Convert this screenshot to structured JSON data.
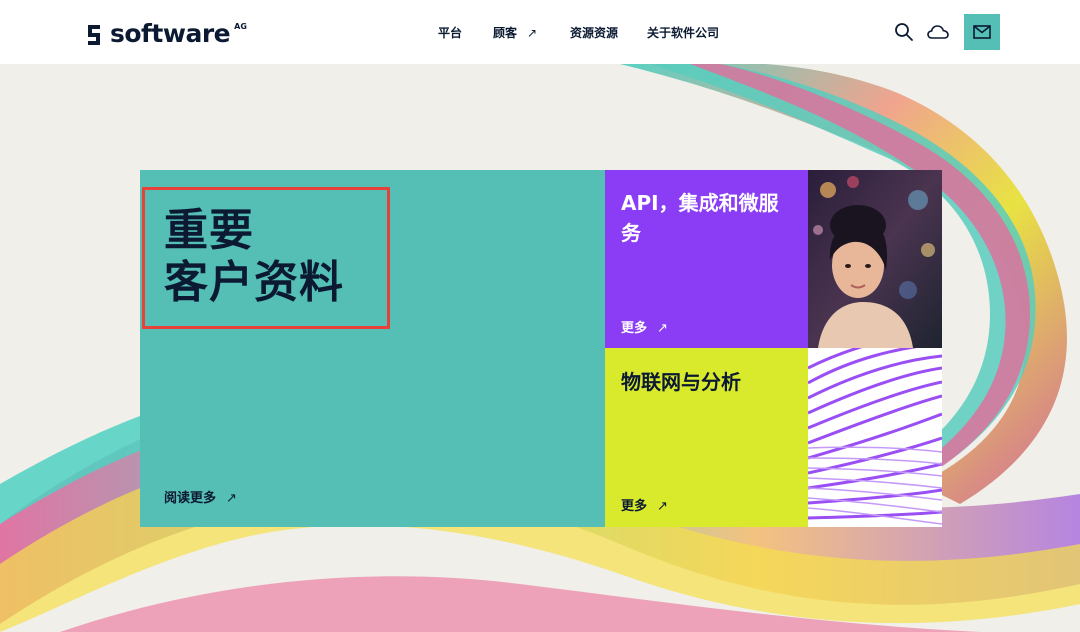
{
  "brand": {
    "name": "software",
    "suffix": "AG"
  },
  "nav": {
    "items": [
      {
        "label": "平台"
      },
      {
        "label": "顾客",
        "arrow": "↗"
      },
      {
        "label": "资源资源"
      },
      {
        "label": "关于软件公司"
      }
    ]
  },
  "header_icons": {
    "search": "search-icon",
    "cloud": "cloud-icon",
    "mail": "mail-icon"
  },
  "hero": {
    "title_line1": "重要",
    "title_line2": "客户资料",
    "read_more": "阅读更多",
    "arrow": "↗"
  },
  "cards": {
    "api": {
      "title": "API，集成和微服务",
      "more": "更多",
      "arrow": "↗"
    },
    "iot": {
      "title": "物联网与分析",
      "more": "更多",
      "arrow": "↗"
    }
  },
  "colors": {
    "teal": "#55bfb5",
    "purple": "#8b3df5",
    "lime": "#d9ea2d",
    "navy": "#0b1a32",
    "highlight": "#e8413a",
    "background": "#f0efe9"
  }
}
